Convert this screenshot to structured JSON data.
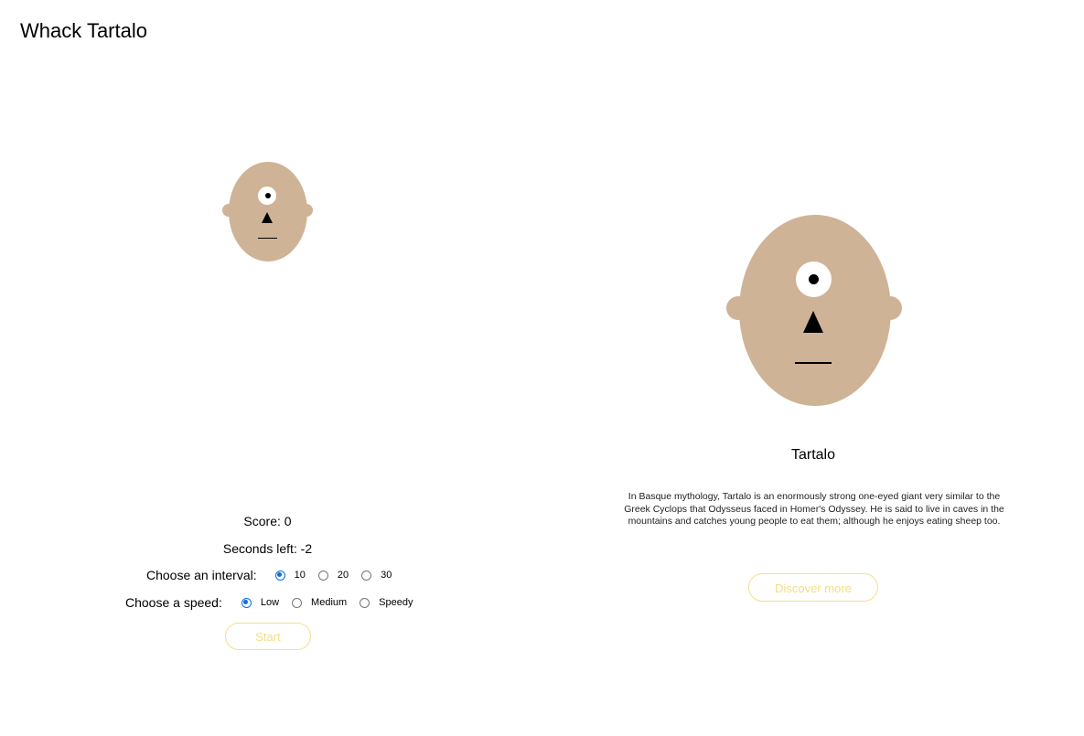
{
  "app": {
    "title": "Whack Tartalo"
  },
  "game": {
    "score_text": "Score: 0",
    "seconds_text": "Seconds left: -2",
    "interval": {
      "label": "Choose an interval:",
      "options": [
        "10",
        "20",
        "30"
      ],
      "selected": "10"
    },
    "speed": {
      "label": "Choose a speed:",
      "options": [
        "Low",
        "Medium",
        "Speedy"
      ],
      "selected": "Low"
    },
    "start_label": "Start"
  },
  "info": {
    "title": "Tartalo",
    "description": "In Basque mythology, Tartalo is an enormously strong one-eyed giant very similar to the Greek Cyclops that Odysseus faced in Homer's Odyssey. He is said to live in caves in the mountains and catches young people to eat them; although he enjoys eating sheep too.",
    "discover_label": "Discover more"
  },
  "colors": {
    "skin": "#cfb396",
    "button_accent": "#f3dd85",
    "radio_checked": "#0b6ede"
  }
}
